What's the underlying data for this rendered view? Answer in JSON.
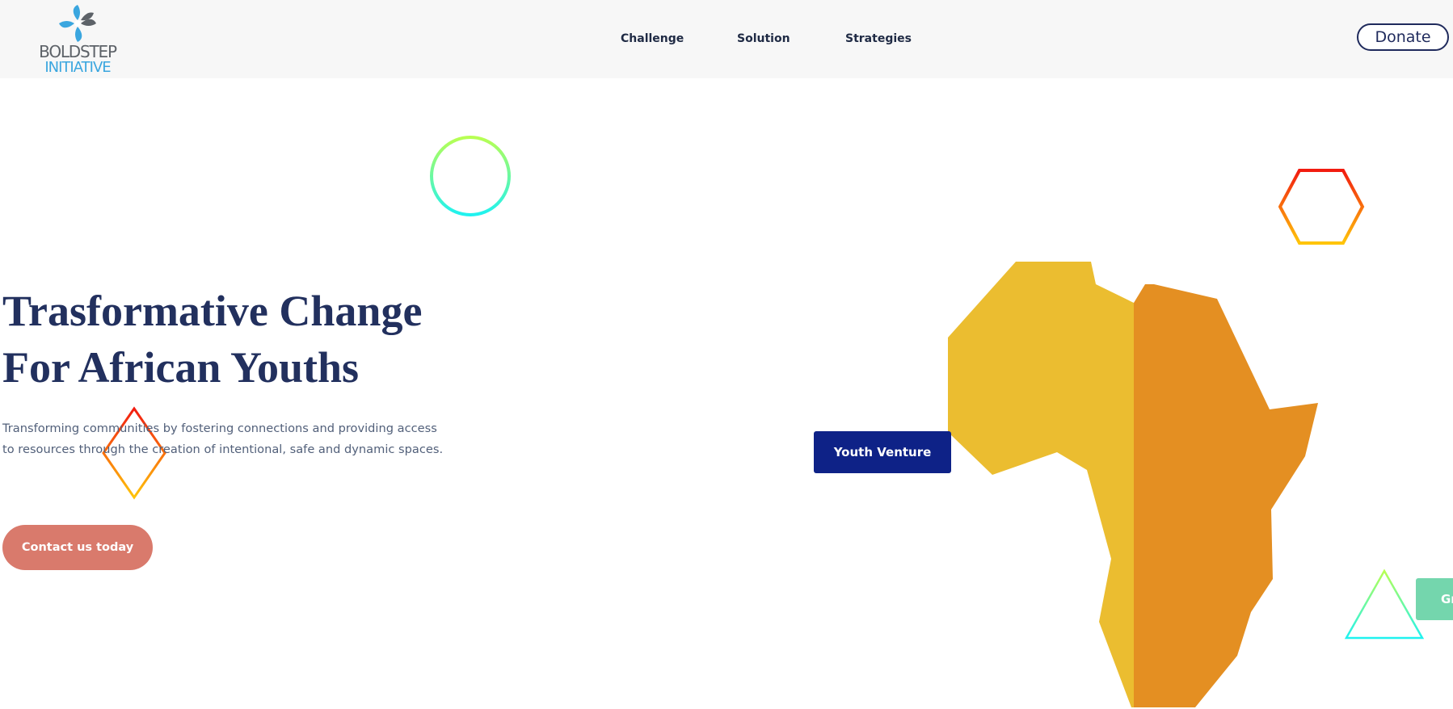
{
  "header": {
    "logo": {
      "line1": "BOLDSTEP",
      "line2": "INITIATIVE",
      "icon": "pinwheel-logo-icon"
    },
    "nav": [
      {
        "label": "Challenge"
      },
      {
        "label": "Solution"
      },
      {
        "label": "Strategies"
      }
    ],
    "donate_label": "Donate"
  },
  "hero": {
    "title_line1": "Trasformative Change",
    "title_line2": "For African Youths",
    "subtitle_line1": "Transforming communities by fostering connections and providing access",
    "subtitle_line2": "to resources through the creation of intentional, safe and dynamic spaces.",
    "cta_label": "Contact us today"
  },
  "floating_buttons": {
    "youth_venture": "Youth Venture",
    "green_partial": "Gr"
  },
  "colors": {
    "header_bg": "#f7f7f7",
    "title": "#22305e",
    "cta": "#d97a6c",
    "youth_venture": "#0e2287",
    "green_button": "#74d6ad",
    "africa_left": "#ebbd30",
    "africa_right": "#e48f22"
  }
}
